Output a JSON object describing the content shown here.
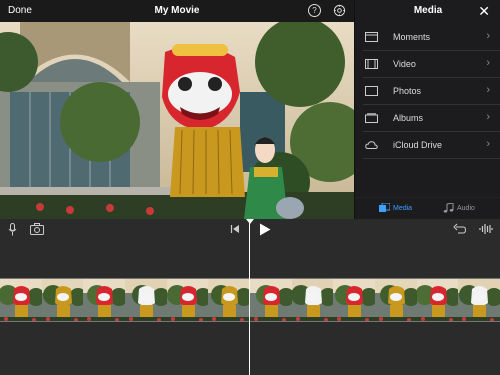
{
  "topbar": {
    "done_label": "Done",
    "title": "My Movie",
    "help_glyph": "?"
  },
  "media": {
    "title": "Media",
    "close_glyph": "✕",
    "items": [
      {
        "label": "Moments",
        "icon": "moments-icon"
      },
      {
        "label": "Video",
        "icon": "video-icon"
      },
      {
        "label": "Photos",
        "icon": "photos-icon"
      },
      {
        "label": "Albums",
        "icon": "albums-icon"
      },
      {
        "label": "iCloud Drive",
        "icon": "cloud-icon"
      }
    ],
    "chevron": "›",
    "tabs": [
      {
        "label": "Media",
        "active": true
      },
      {
        "label": "Audio",
        "active": false
      }
    ]
  },
  "colors": {
    "accent": "#3ea0ff",
    "panel": "#1c1c1e",
    "background": "#2b2b2b"
  }
}
